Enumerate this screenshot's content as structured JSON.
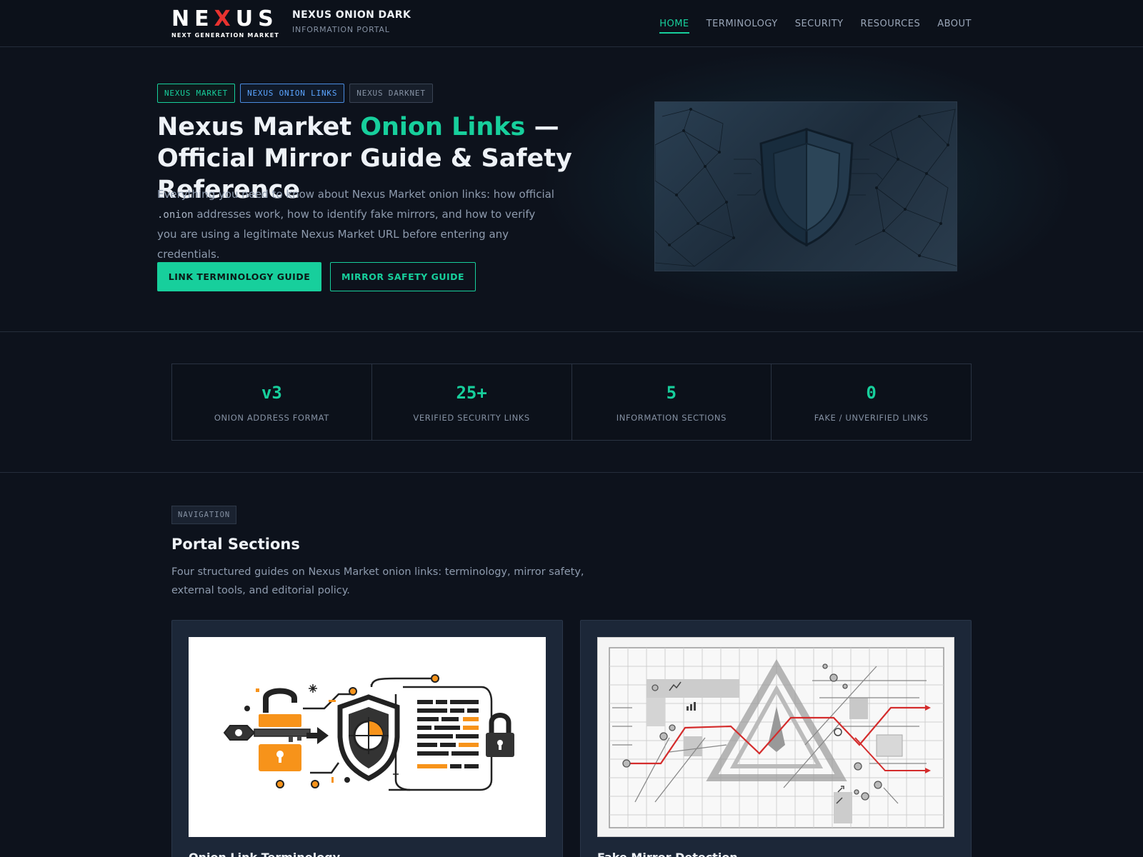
{
  "header": {
    "logo_word_a": "NE",
    "logo_word_x": "X",
    "logo_word_b": "US",
    "logo_sub": "NEXT GENERATION MARKET",
    "brand_title": "NEXUS ONION DARK",
    "brand_sub": "INFORMATION PORTAL",
    "nav": [
      {
        "label": "HOME",
        "active": true
      },
      {
        "label": "TERMINOLOGY",
        "active": false
      },
      {
        "label": "SECURITY",
        "active": false
      },
      {
        "label": "RESOURCES",
        "active": false
      },
      {
        "label": "ABOUT",
        "active": false
      }
    ]
  },
  "hero": {
    "tags": [
      "NEXUS MARKET",
      "NEXUS ONION LINKS",
      "NEXUS DARKNET"
    ],
    "title_a": "Nexus Market ",
    "title_accent": "Onion Links",
    "title_b": " — Official Mirror Guide & Safety Reference",
    "desc_a": "Everything you need to know about Nexus Market onion links: how official ",
    "desc_code": ".onion",
    "desc_b": " addresses work, how to identify fake mirrors, and how to verify you are using a legitimate Nexus Market URL before entering any credentials.",
    "primary_button": "LINK TERMINOLOGY GUIDE",
    "secondary_button": "MIRROR SAFETY GUIDE"
  },
  "stats": [
    {
      "value": "v3",
      "label": "ONION ADDRESS FORMAT"
    },
    {
      "value": "25+",
      "label": "VERIFIED SECURITY LINKS"
    },
    {
      "value": "5",
      "label": "INFORMATION SECTIONS"
    },
    {
      "value": "0",
      "label": "FAKE / UNVERIFIED LINKS"
    }
  ],
  "sections": {
    "tag": "NAVIGATION",
    "title": "Portal Sections",
    "desc": "Four structured guides on Nexus Market onion links: terminology, mirror safety, external tools, and editorial policy.",
    "cards": [
      {
        "title": "Onion Link Terminology"
      },
      {
        "title": "Fake Mirror Detection"
      }
    ]
  },
  "colors": {
    "accent": "#17cf9c",
    "logo_x": "#e8322f",
    "background": "#0d121c",
    "card": "#1c2738",
    "illustration_orange": "#f7931a"
  }
}
